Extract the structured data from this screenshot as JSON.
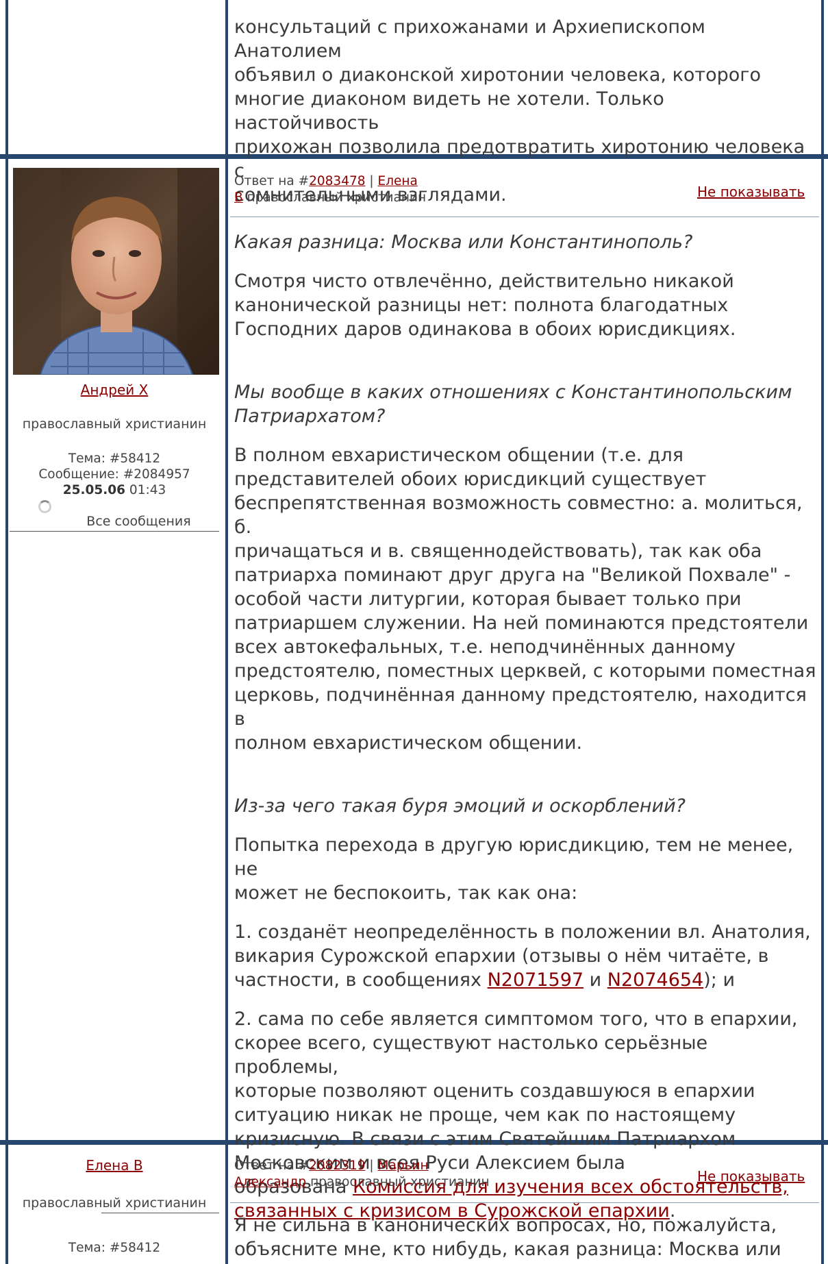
{
  "post0": {
    "lines": [
      "консультаций с прихожанами и Архиепископом Анатолием",
      "объявил о диаконской хиротонии человека, которого",
      "многие диаконом видеть не хотели. Только настойчивость",
      "прихожан позволила предотвратить хиротонию человека с",
      "сомнительными взглядами."
    ]
  },
  "post1": {
    "header": {
      "reply_prefix": "Ответ на #",
      "reply_id": "2083478",
      "sep": " | ",
      "reply_author_a": "Елена",
      "reply_author_b": "В",
      "reply_role": " православный христианин",
      "hide": "Не показывать"
    },
    "sidebar": {
      "author": "Андрей Х",
      "role": "православный христианин",
      "topic": "Тема: #58412",
      "message": "Сообщение: #2084957",
      "date": "25.05.06",
      "time": " 01:43",
      "all_messages": "Все сообщения"
    },
    "q1": "Какая разница: Москва или Константинополь?",
    "a1": [
      "Смотря чисто отвлечённо, действительно никакой",
      "канонической разницы нет: полнота благодатных",
      "Господних даров одинакова в обоих юрисдикциях."
    ],
    "q2": [
      "Мы вообще в каких отношениях с Константинопольским",
      "Патриархатом?"
    ],
    "a2": [
      "В полном евхаристическом общении (т.е. для",
      "представителей обоих юрисдикций существует",
      "беспрепятственная возможность совместно: а. молиться, б.",
      "причащаться и в. священнодействовать), так как оба",
      "патриарха поминают друг друга на \"Великой Похвале\" -",
      "особой части литургии, которая бывает только при",
      "патриаршем служении. На ней поминаются предстоятели",
      "всех автокефальных, т.е. неподчинённых данному",
      "предстоятелю, поместных церквей, с которыми поместная",
      "церковь, подчинённая данному предстоятелю, находится в",
      "полном евхаристическом общении."
    ],
    "q3": "Из-за чего такая буря эмоций и оскорблений?",
    "a3": [
      "Попытка перехода в другую юрисдикцию, тем не менее, не",
      "может не беспокоить, так как она:"
    ],
    "p1": {
      "l1": "1. созданёт неопределённость в положении вл. Анатолия,",
      "l2": "викария Сурожской епархии (отзывы о нём читаёте, в",
      "l3_pre": "частности, в сообщениях ",
      "link1": "N2071597",
      "l3_mid": " и ",
      "link2": "N2074654",
      "l3_post": "); и"
    },
    "p2": {
      "lines": [
        "2. сама по себе является симптомом того, что в епархии,",
        "скорее всего, существуют настолько серьёзные проблемы,",
        "которые позволяют оценить создавшуюся в епархии",
        "ситуацию никак не проще, чем как по настоящему",
        "кризисную. В связи с этим Святейшим Патриархом",
        "Московским и всея Руси Алексием была"
      ],
      "pre": "образована ",
      "link_a": "Комиссия для изучения всех обстоятельств,",
      "link_b": "связанных с кризисом в Сурожской епархии",
      "post": "."
    }
  },
  "post2": {
    "header": {
      "reply_prefix": "Ответ на #",
      "reply_id": "2082319",
      "sep": " | ",
      "reply_author_a": "Марьин",
      "reply_author_b": "Александр",
      "reply_role": " православный христианин",
      "hide": "Не показывать"
    },
    "sidebar": {
      "author": "Елена В",
      "role": "православный христианин",
      "topic": "Тема: #58412"
    },
    "lines": [
      "Я не сильна в канонических вопросах, но, пожалуйста,",
      "объясните мне, кто нибудь, какая разница: Москва или"
    ]
  }
}
